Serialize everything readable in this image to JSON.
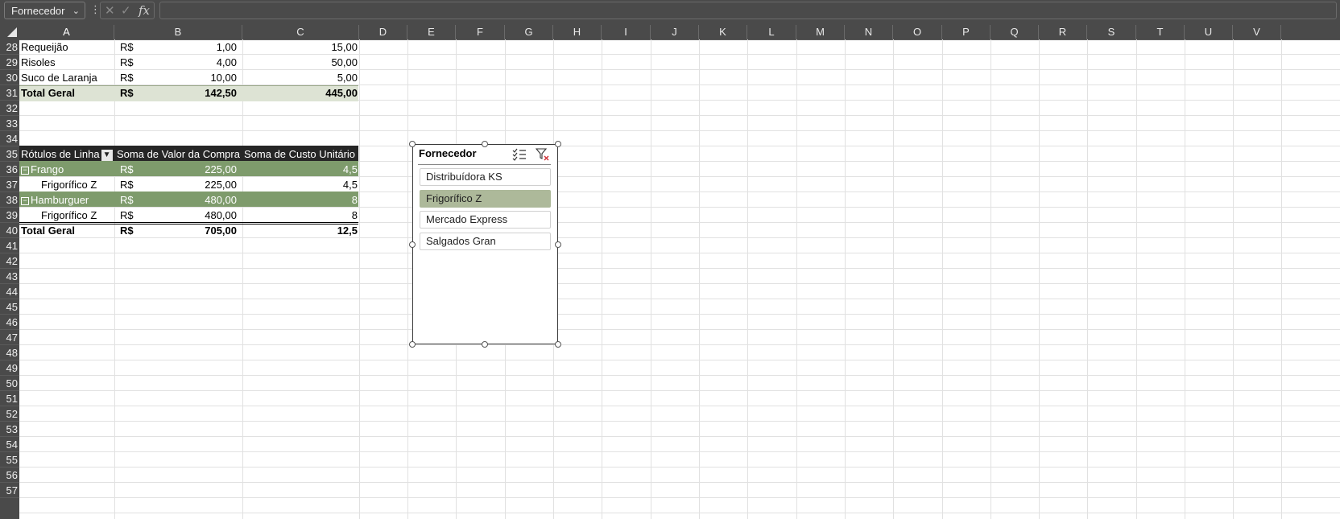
{
  "formula_bar": {
    "name_box": "Fornecedor",
    "cancel": "✕",
    "enter": "✓",
    "fx": "fx",
    "content": ""
  },
  "columns": [
    "A",
    "B",
    "C",
    "D",
    "E",
    "F",
    "G",
    "H",
    "I",
    "J",
    "K",
    "L",
    "M",
    "N",
    "O",
    "P",
    "Q",
    "R",
    "S",
    "T",
    "U",
    "V"
  ],
  "rows": [
    "28",
    "29",
    "30",
    "31",
    "32",
    "33",
    "34",
    "35",
    "36",
    "37",
    "38",
    "39",
    "40",
    "41",
    "42",
    "43",
    "44",
    "45",
    "46",
    "47",
    "48",
    "49",
    "50",
    "51",
    "52",
    "53",
    "54",
    "55",
    "56",
    "57"
  ],
  "table1": {
    "rows": [
      {
        "a": "Requeijão",
        "b_cur": "R$",
        "b": "1,00",
        "c": "15,00"
      },
      {
        "a": "Risoles",
        "b_cur": "R$",
        "b": "4,00",
        "c": "50,00"
      },
      {
        "a": "Suco de Laranja",
        "b_cur": "R$",
        "b": "10,00",
        "c": "5,00"
      }
    ],
    "total": {
      "a": "Total Geral",
      "b_cur": "R$",
      "b": "142,50",
      "c": "445,00"
    }
  },
  "pivot": {
    "header": {
      "a": "Rótulos de Linha",
      "b": "Soma de Valor da Compra",
      "c": "Soma de Custo Unitário"
    },
    "rows": [
      {
        "type": "group",
        "a": "Frango",
        "b_cur": "R$",
        "b": "225,00",
        "c": "4,5"
      },
      {
        "type": "detail",
        "a": "Frigorífico Z",
        "b_cur": "R$",
        "b": "225,00",
        "c": "4,5"
      },
      {
        "type": "group",
        "a": "Hamburguer",
        "b_cur": "R$",
        "b": "480,00",
        "c": "8"
      },
      {
        "type": "detail",
        "a": "Frigorífico Z",
        "b_cur": "R$",
        "b": "480,00",
        "c": "8"
      }
    ],
    "total": {
      "a": "Total Geral",
      "b_cur": "R$",
      "b": "705,00",
      "c": "12,5"
    }
  },
  "slicer": {
    "title": "Fornecedor",
    "items": [
      {
        "label": "Distribuídora KS",
        "selected": false
      },
      {
        "label": "Frigorífico Z",
        "selected": true
      },
      {
        "label": "Mercado Express",
        "selected": false
      },
      {
        "label": "Salgados Gran",
        "selected": false
      }
    ]
  },
  "colors": {
    "pivot_header": "#262626",
    "pivot_group": "#7e9b6c",
    "total_band": "#dde3d4",
    "slicer_selected": "#adb99a"
  }
}
